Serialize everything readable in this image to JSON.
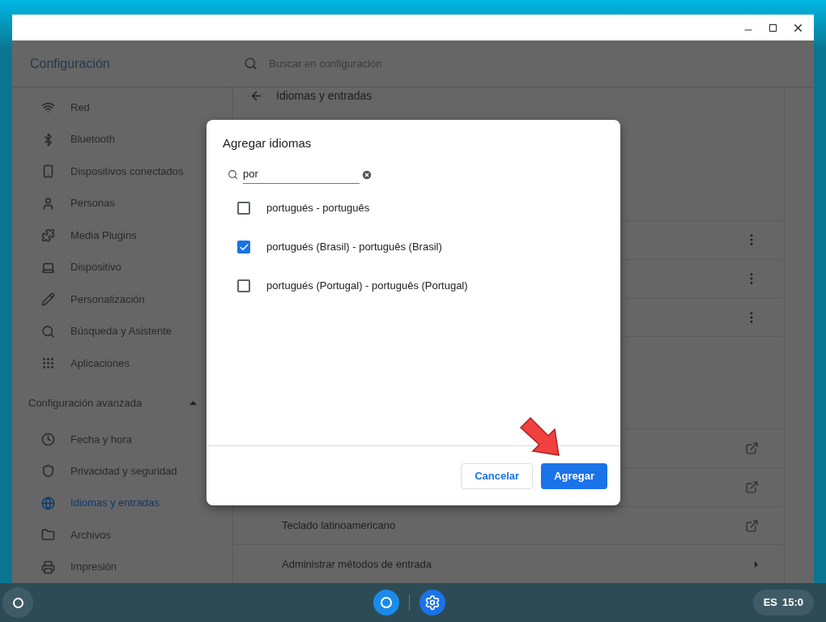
{
  "header": {
    "title": "Configuración",
    "search_placeholder": "Buscar en configuración"
  },
  "sidebar": {
    "items": [
      {
        "label": "Red",
        "kind": "wifi",
        "selected": false
      },
      {
        "label": "Bluetooth",
        "kind": "bluetooth",
        "selected": false
      },
      {
        "label": "Dispositivos conectados",
        "kind": "phone",
        "selected": false
      },
      {
        "label": "Personas",
        "kind": "person",
        "selected": false
      },
      {
        "label": "Media Plugins",
        "kind": "puzzle",
        "selected": false
      },
      {
        "label": "Dispositivo",
        "kind": "laptop",
        "selected": false
      },
      {
        "label": "Personalización",
        "kind": "brush",
        "selected": false
      },
      {
        "label": "Búsqueda y Asistente",
        "kind": "search",
        "selected": false
      },
      {
        "label": "Aplicaciones",
        "kind": "grid",
        "selected": false
      }
    ],
    "advanced": {
      "label": "Configuración avanzada",
      "expanded": true
    },
    "advanced_items": [
      {
        "label": "Fecha y hora",
        "kind": "clock",
        "selected": false
      },
      {
        "label": "Privacidad y seguridad",
        "kind": "shield",
        "selected": false
      },
      {
        "label": "Idiomas y entradas",
        "kind": "globe",
        "selected": true
      },
      {
        "label": "Archivos",
        "kind": "folder",
        "selected": false
      },
      {
        "label": "Impresión",
        "kind": "printer",
        "selected": false
      }
    ]
  },
  "page": {
    "title": "Idiomas y entradas",
    "rows": [
      {
        "kind": "menu"
      },
      {
        "kind": "menu"
      },
      {
        "kind": "menu"
      },
      {
        "kind": "external"
      },
      {
        "kind": "external"
      },
      {
        "kind": "external",
        "label": "Teclado latinoamericano"
      },
      {
        "kind": "submenu",
        "label": "Administrar métodos de entrada"
      }
    ]
  },
  "dialog": {
    "title": "Agregar idiomas",
    "search_value": "por",
    "options": [
      {
        "label": "portugués - português",
        "checked": false
      },
      {
        "label": "portugués (Brasil) - português (Brasil)",
        "checked": true
      },
      {
        "label": "portugués (Portugal) - português (Portugal)",
        "checked": false
      }
    ],
    "buttons": [
      {
        "label": "Cancelar",
        "kind": "secondary"
      },
      {
        "label": "Agregar",
        "kind": "primary"
      }
    ]
  },
  "taskbar": {
    "apps": [
      {
        "kind": "browser"
      },
      {
        "kind": "settings"
      }
    ],
    "language": "ES",
    "time": "15:0"
  }
}
